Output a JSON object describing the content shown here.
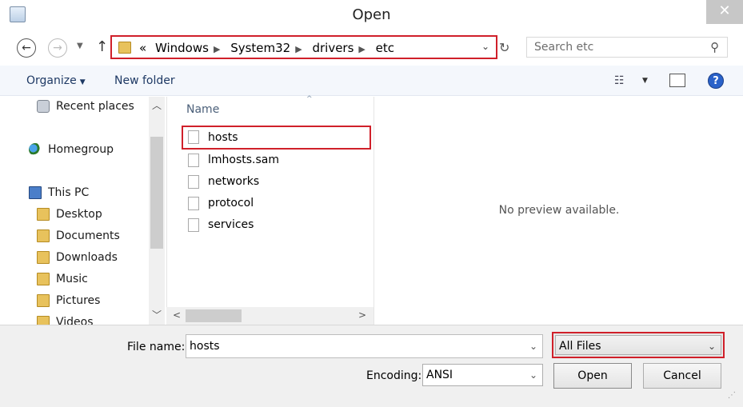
{
  "window": {
    "title": "Open",
    "close_glyph": "✕"
  },
  "nav": {
    "back_icon": "back-arrow-icon",
    "forward_icon": "forward-arrow-icon",
    "up_icon": "up-arrow-icon",
    "breadcrumb_prefix": "«",
    "breadcrumbs": [
      "Windows",
      "System32",
      "drivers",
      "etc"
    ],
    "search_placeholder": "Search etc"
  },
  "toolbar": {
    "organize": "Organize",
    "new_folder": "New folder"
  },
  "sidebar": {
    "items": [
      {
        "label": "Recent places",
        "icon": "recent-places-icon"
      },
      {
        "label": "Homegroup",
        "icon": "homegroup-icon"
      },
      {
        "label": "This PC",
        "icon": "computer-icon"
      },
      {
        "label": "Desktop",
        "icon": "folder-icon"
      },
      {
        "label": "Documents",
        "icon": "folder-icon"
      },
      {
        "label": "Downloads",
        "icon": "folder-icon"
      },
      {
        "label": "Music",
        "icon": "folder-icon"
      },
      {
        "label": "Pictures",
        "icon": "folder-icon"
      },
      {
        "label": "Videos",
        "icon": "folder-icon"
      }
    ]
  },
  "files": {
    "column_header": "Name",
    "items": [
      "hosts",
      "lmhosts.sam",
      "networks",
      "protocol",
      "services"
    ],
    "selected": "hosts"
  },
  "preview": {
    "message": "No preview available."
  },
  "bottom": {
    "file_name_label": "File name:",
    "file_name_value": "hosts",
    "file_type_value": "All Files",
    "encoding_label": "Encoding:",
    "encoding_value": "ANSI",
    "open_button": "Open",
    "cancel_button": "Cancel"
  },
  "colors": {
    "highlight_border": "#d0202a",
    "toolbar_bg": "#f4f7fc",
    "link_text": "#1e3964"
  }
}
